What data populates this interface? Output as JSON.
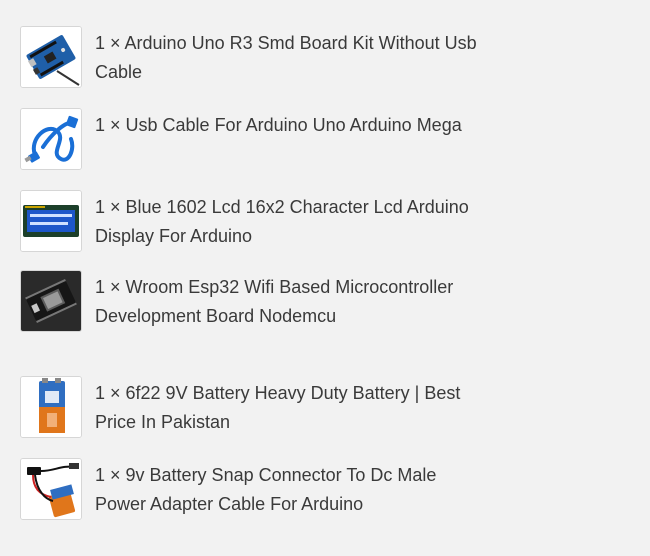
{
  "partial_text": "- - - -",
  "order_items": [
    {
      "title": "1 × Arduino Uno R3 Smd Board Kit Without Usb Cable",
      "thumb_icon": "arduino-board-icon"
    },
    {
      "title": "1 × Usb Cable For Arduino Uno Arduino Mega",
      "thumb_icon": "usb-cable-icon"
    },
    {
      "title": "1 × Blue 1602 Lcd 16x2 Character Lcd Arduino Display For Arduino",
      "thumb_icon": "lcd-display-icon"
    },
    {
      "title": "1 × Wroom Esp32 Wifi Based Microcontroller Development Board Nodemcu",
      "thumb_icon": "esp32-board-icon"
    },
    {
      "title": "1 × 6f22 9V Battery Heavy Duty Battery | Best Price In Pakistan",
      "thumb_icon": "battery-9v-icon"
    },
    {
      "title": "1 × 9v Battery Snap Connector To Dc Male Power Adapter Cable For Arduino",
      "thumb_icon": "battery-snap-connector-icon"
    }
  ],
  "colors": {
    "background": "#f2f2f2",
    "text": "#3a3a3a",
    "thumb_border": "#d6d6d6"
  }
}
